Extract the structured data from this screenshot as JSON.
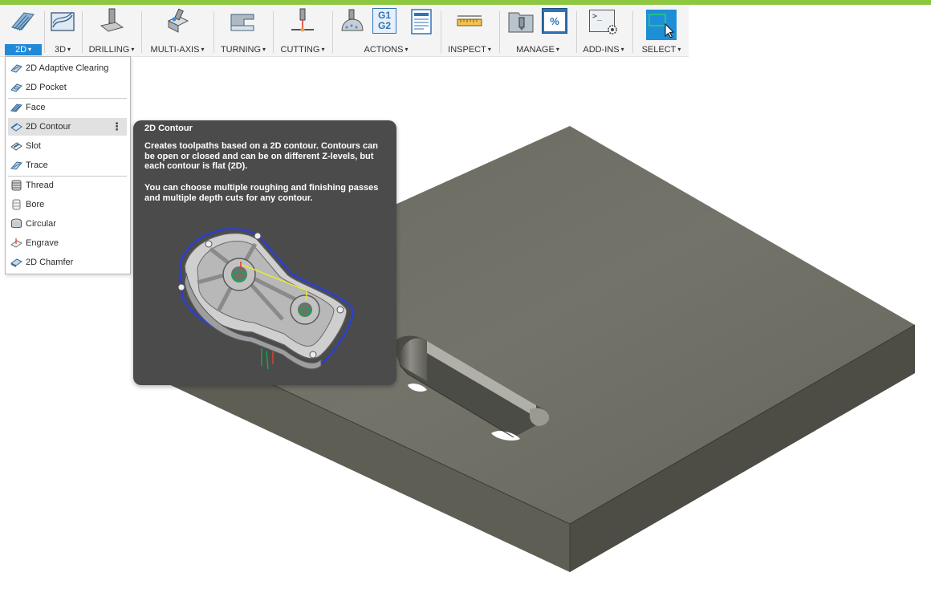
{
  "toolbar": {
    "groups": [
      {
        "label": "2D",
        "icon": "2d-milling-icon"
      },
      {
        "label": "3D",
        "icon": "3d-milling-icon"
      },
      {
        "label": "DRILLING",
        "icon": "drill-icon"
      },
      {
        "label": "MULTI-AXIS",
        "icon": "multi-axis-icon"
      },
      {
        "label": "TURNING",
        "icon": "turning-icon"
      },
      {
        "label": "CUTTING",
        "icon": "cutting-icon"
      },
      {
        "label": "ACTIONS",
        "icon": "actions-icon",
        "icon_text": [
          "G1",
          "G2"
        ]
      },
      {
        "label": "INSPECT",
        "icon": "ruler-icon"
      },
      {
        "label": "MANAGE",
        "icon": "manage-icon",
        "icon_text": "%"
      },
      {
        "label": "ADD-INS",
        "icon": "add-ins-icon",
        "icon_text": ">_"
      },
      {
        "label": "SELECT",
        "icon": "select-icon"
      }
    ],
    "active_group": "2D",
    "caret": "▾"
  },
  "menu": {
    "items": [
      {
        "label": "2D Adaptive Clearing",
        "icon": "adaptive-clearing-icon"
      },
      {
        "label": "2D Pocket",
        "icon": "pocket-icon"
      },
      {
        "label": "Face",
        "icon": "face-icon"
      },
      {
        "label": "2D Contour",
        "icon": "contour-icon",
        "highlighted": true,
        "more": "⋮"
      },
      {
        "label": "Slot",
        "icon": "slot-icon"
      },
      {
        "label": "Trace",
        "icon": "trace-icon"
      },
      {
        "label": "Thread",
        "icon": "thread-icon"
      },
      {
        "label": "Bore",
        "icon": "bore-icon"
      },
      {
        "label": "Circular",
        "icon": "circular-icon"
      },
      {
        "label": "Engrave",
        "icon": "engrave-icon"
      },
      {
        "label": "2D Chamfer",
        "icon": "chamfer-icon"
      }
    ]
  },
  "tooltip": {
    "title": "2D Contour",
    "paragraph1": "Creates toolpaths based on a 2D contour. Contours can be open or closed and can be on different Z-levels, but each contour is flat (2D).",
    "paragraph2": "You can choose multiple roughing and finishing passes and multiple depth cuts for any contour."
  },
  "colors": {
    "accent_bar": "#8dc63f",
    "active_tab": "#1f8ad8",
    "tooltip_bg": "#4b4b4b",
    "model_face": "#6e6e64"
  }
}
